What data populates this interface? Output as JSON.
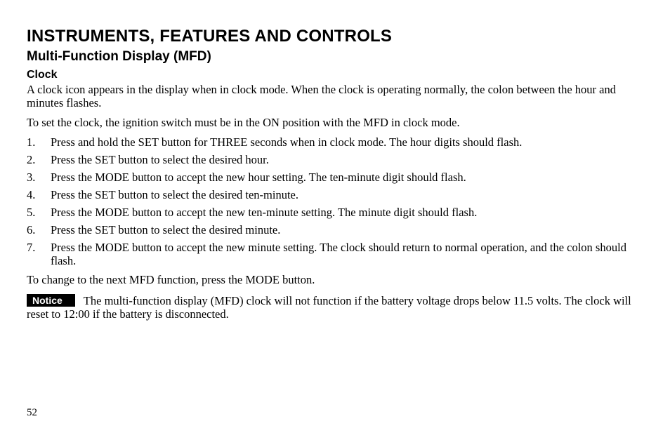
{
  "header": {
    "chapter": "INSTRUMENTS, FEATURES AND CONTROLS",
    "section": "Multi-Function Display (MFD)",
    "subsection": "Clock"
  },
  "intro": {
    "p1": "A clock icon appears in the display when in clock mode. When the clock is operating normally, the colon between the hour and minutes flashes.",
    "p2": "To set the clock, the ignition switch must be in the ON position with the MFD in clock mode."
  },
  "steps": [
    "Press and hold the SET button for THREE seconds when in clock mode. The hour digits should flash.",
    "Press the SET button to select the desired hour.",
    "Press the MODE button to accept the new hour setting. The ten-minute digit should flash.",
    "Press the SET button to select the desired ten-minute.",
    "Press the MODE button to accept the new ten-minute setting. The minute digit should flash.",
    "Press the SET button to select the desired minute.",
    "Press the MODE button to accept the new minute setting. The clock should return to normal operation, and the colon should flash."
  ],
  "outro": "To change to the next MFD function, press the MODE button.",
  "notice": {
    "label": "Notice",
    "text": "The multi-function display (MFD) clock  will not function if the battery voltage drops below 11.5 volts. The clock will reset to 12:00 if the battery is disconnected."
  },
  "page_number": "52"
}
